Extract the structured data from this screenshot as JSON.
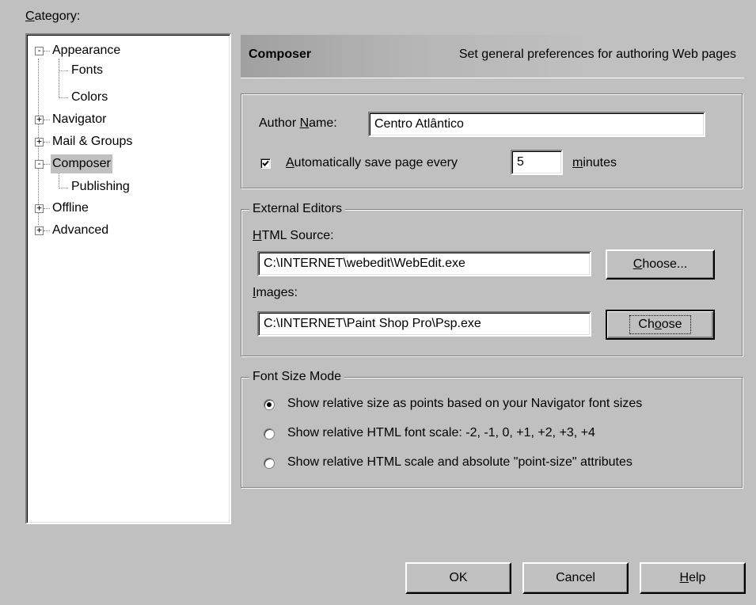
{
  "category": {
    "label_prefix": "",
    "label_underlined": "C",
    "label_rest": "ategory:",
    "tree": [
      {
        "label": "Appearance",
        "toggle": "-"
      },
      {
        "label": "Fonts"
      },
      {
        "label": "Colors"
      },
      {
        "label": "Navigator",
        "toggle": "+"
      },
      {
        "label": "Mail & Groups",
        "toggle": "+"
      },
      {
        "label": "Composer",
        "toggle": "-"
      },
      {
        "label": "Publishing"
      },
      {
        "label": "Offline",
        "toggle": "+"
      },
      {
        "label": "Advanced",
        "toggle": "+"
      }
    ]
  },
  "header": {
    "title": "Composer",
    "description": "Set general preferences for authoring Web pages"
  },
  "author": {
    "label_pre": "Author ",
    "label_u": "N",
    "label_post": "ame:",
    "value": "Centro Atlântico"
  },
  "autosave": {
    "checked": true,
    "label_u": "A",
    "label_post": "utomatically save page every",
    "value": "5",
    "unit_u": "m",
    "unit_post": "inutes"
  },
  "external_editors": {
    "legend": "External Editors",
    "html_label_u": "H",
    "html_label_post": "TML Source:",
    "html_value": "C:\\INTERNET\\webedit\\WebEdit.exe",
    "choose1_u": "C",
    "choose1_post": "hoose...",
    "images_label_u": "I",
    "images_label_post": "mages:",
    "images_value": "C:\\INTERNET\\Paint Shop Pro\\Psp.exe",
    "choose2_pre": "Ch",
    "choose2_u": "o",
    "choose2_post": "ose"
  },
  "font_size_mode": {
    "legend": "Font Size Mode",
    "options": [
      "Show relative size as points based on your Navigator font sizes",
      "Show relative HTML font scale: -2, -1, 0, +1, +2, +3, +4",
      "Show relative HTML scale and absolute \"point-size\" attributes"
    ],
    "selected_index": 0
  },
  "buttons": {
    "ok": "OK",
    "cancel": "Cancel",
    "help_u": "H",
    "help_post": "elp"
  }
}
